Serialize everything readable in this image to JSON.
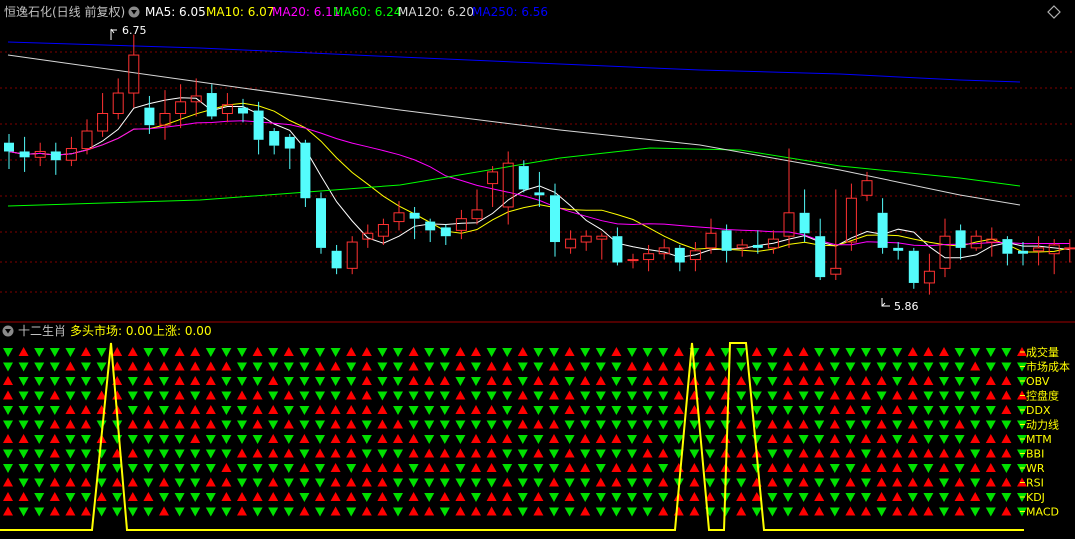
{
  "main_panel": {
    "title": "恒逸石化(日线 前复权)",
    "ma_items": [
      {
        "label": "MA5: 6.05",
        "color": "#ffffff"
      },
      {
        "label": "MA10: 6.07",
        "color": "#ffff00"
      },
      {
        "label": "MA20: 6.11",
        "color": "#ff00ff"
      },
      {
        "label": "MA60: 6.24",
        "color": "#00ff00"
      },
      {
        "label": "MA120: 6.20",
        "color": "#d8d8d8"
      },
      {
        "label": "MA250: 6.56",
        "color": "#0000ff"
      }
    ],
    "high_marker": "6.75",
    "low_marker": "5.86"
  },
  "sub_panel": {
    "title": "十二生肖",
    "items": [
      {
        "label": "多头市场: 0.00",
        "color": "#ffff00"
      },
      {
        "label": "上涨: 0.00",
        "color": "#ffff00"
      }
    ],
    "row_labels": [
      "成交量",
      "市场成本",
      "OBV",
      "控盘度",
      "DDX",
      "动力线",
      "MTM",
      "BBI",
      "WR",
      "RSI",
      "KDJ",
      "MACD"
    ]
  },
  "colors": {
    "up": "#ff3232",
    "down": "#54fcfc",
    "bull": "#ff0000",
    "bear": "#00e000",
    "grid": "#800000",
    "signal": "#ffff00"
  },
  "chart_data": {
    "type": "candlestick",
    "series": [
      {
        "name": "K",
        "values": [
          [
            6.38,
            6.35,
            6.41,
            6.29
          ],
          [
            6.35,
            6.33,
            6.4,
            6.28
          ],
          [
            6.33,
            6.35,
            6.38,
            6.3
          ],
          [
            6.35,
            6.32,
            6.38,
            6.27
          ],
          [
            6.32,
            6.36,
            6.4,
            6.3
          ],
          [
            6.36,
            6.42,
            6.46,
            6.34
          ],
          [
            6.42,
            6.48,
            6.55,
            6.4
          ],
          [
            6.48,
            6.55,
            6.6,
            6.46
          ],
          [
            6.55,
            6.68,
            6.75,
            6.5
          ],
          [
            6.5,
            6.44,
            6.54,
            6.41
          ],
          [
            6.44,
            6.48,
            6.56,
            6.39
          ],
          [
            6.48,
            6.52,
            6.58,
            6.43
          ],
          [
            6.52,
            6.54,
            6.6,
            6.47
          ],
          [
            6.55,
            6.47,
            6.58,
            6.46
          ],
          [
            6.48,
            6.51,
            6.55,
            6.45
          ],
          [
            6.5,
            6.48,
            6.53,
            6.45
          ],
          [
            6.49,
            6.39,
            6.52,
            6.34
          ],
          [
            6.42,
            6.37,
            6.43,
            6.34
          ],
          [
            6.4,
            6.36,
            6.41,
            6.29
          ],
          [
            6.38,
            6.19,
            6.39,
            6.16
          ],
          [
            6.19,
            6.02,
            6.21,
            6.0
          ],
          [
            6.01,
            5.95,
            6.03,
            5.93
          ],
          [
            5.95,
            6.04,
            6.06,
            5.93
          ],
          [
            6.05,
            6.07,
            6.1,
            6.02
          ],
          [
            6.06,
            6.1,
            6.12,
            6.03
          ],
          [
            6.11,
            6.14,
            6.18,
            6.08
          ],
          [
            6.14,
            6.12,
            6.16,
            6.05
          ],
          [
            6.11,
            6.08,
            6.12,
            6.04
          ],
          [
            6.09,
            6.06,
            6.1,
            6.03
          ],
          [
            6.08,
            6.12,
            6.15,
            6.05
          ],
          [
            6.12,
            6.15,
            6.22,
            6.1
          ],
          [
            6.24,
            6.28,
            6.3,
            6.16
          ],
          [
            6.16,
            6.31,
            6.35,
            6.1
          ],
          [
            6.3,
            6.22,
            6.32,
            6.21
          ],
          [
            6.21,
            6.2,
            6.28,
            6.16
          ],
          [
            6.2,
            6.04,
            6.24,
            5.99
          ],
          [
            6.02,
            6.05,
            6.08,
            6.0
          ],
          [
            6.04,
            6.06,
            6.08,
            6.01
          ],
          [
            6.05,
            6.06,
            6.07,
            5.98
          ],
          [
            6.06,
            5.97,
            6.09,
            5.96
          ],
          [
            5.98,
            5.98,
            6.0,
            5.95
          ],
          [
            5.98,
            6.0,
            6.03,
            5.94
          ],
          [
            6.0,
            6.02,
            6.05,
            5.98
          ],
          [
            6.02,
            5.97,
            6.03,
            5.94
          ],
          [
            5.98,
            6.01,
            6.04,
            5.94
          ],
          [
            6.02,
            6.07,
            6.12,
            6.0
          ],
          [
            6.08,
            6.01,
            6.1,
            5.97
          ],
          [
            6.02,
            6.03,
            6.05,
            5.99
          ],
          [
            6.03,
            6.02,
            6.08,
            6.0
          ],
          [
            6.02,
            6.05,
            6.08,
            6.0
          ],
          [
            6.06,
            6.14,
            6.36,
            6.02
          ],
          [
            6.14,
            6.07,
            6.22,
            6.04
          ],
          [
            6.06,
            5.92,
            6.12,
            5.91
          ],
          [
            5.93,
            5.95,
            6.22,
            5.91
          ],
          [
            6.04,
            6.19,
            6.24,
            6.01
          ],
          [
            6.2,
            6.25,
            6.28,
            6.18
          ],
          [
            6.14,
            6.02,
            6.19,
            6.0
          ],
          [
            6.02,
            6.01,
            6.04,
            5.98
          ],
          [
            6.01,
            5.9,
            6.02,
            5.88
          ],
          [
            5.9,
            5.94,
            6.0,
            5.86
          ],
          [
            5.95,
            6.06,
            6.12,
            5.92
          ],
          [
            6.08,
            6.02,
            6.1,
            5.98
          ],
          [
            6.02,
            6.06,
            6.08,
            6.01
          ],
          [
            6.04,
            6.05,
            6.09,
            5.99
          ],
          [
            6.05,
            6.0,
            6.06,
            5.96
          ],
          [
            6.01,
            6.0,
            6.04,
            5.96
          ],
          [
            6.01,
            6.02,
            6.06,
            5.96
          ],
          [
            6.0,
            6.03,
            6.05,
            5.93
          ],
          [
            6.02,
            6.02,
            6.05,
            5.97
          ]
        ]
      }
    ],
    "ylim": [
      5.78,
      6.8
    ]
  },
  "signal_chart": {
    "peaks": [
      8,
      49,
      51,
      52
    ]
  }
}
